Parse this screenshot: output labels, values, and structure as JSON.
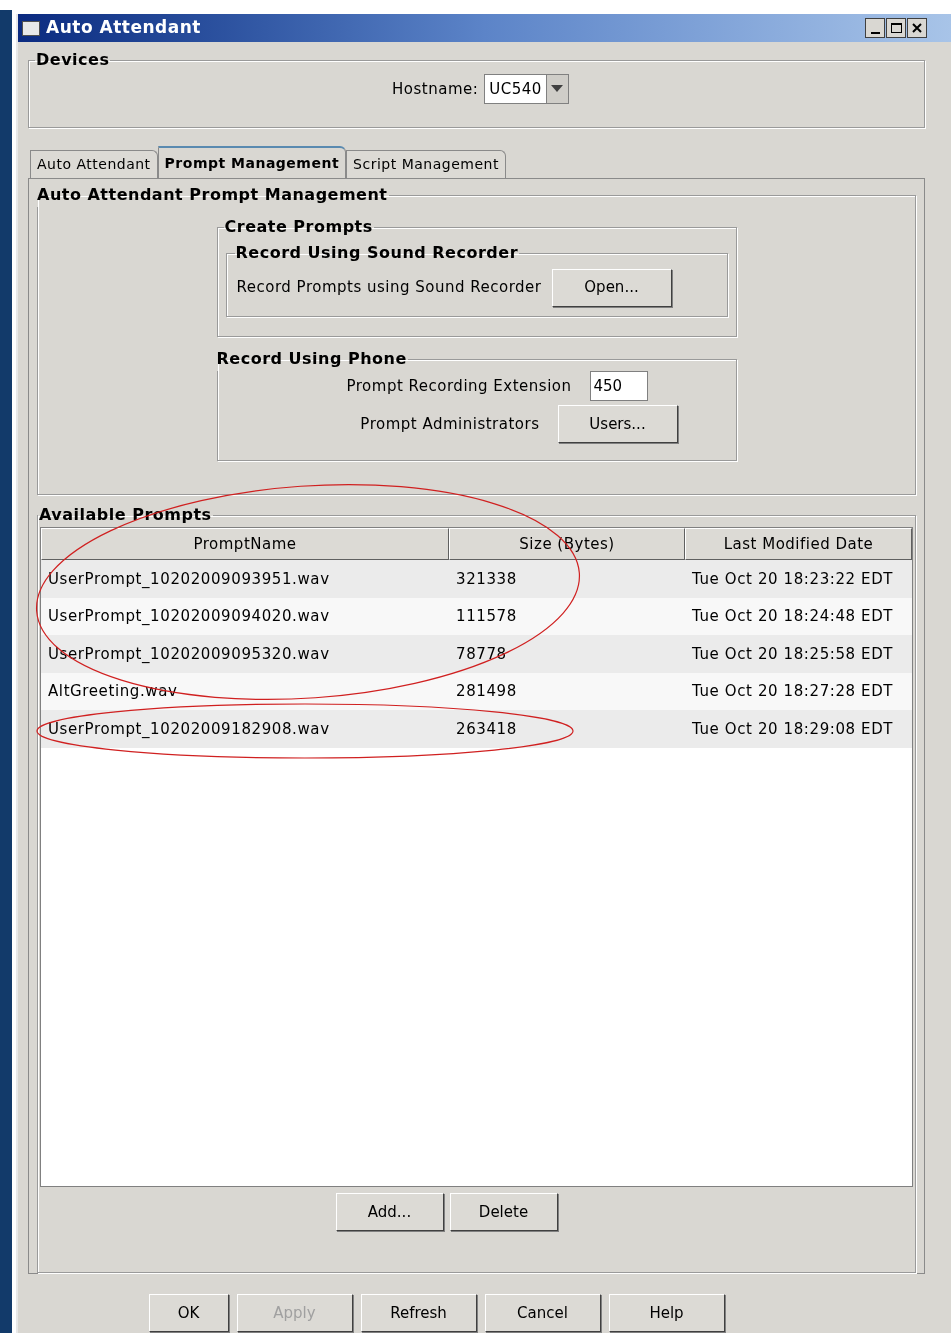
{
  "window": {
    "title": "Auto Attendant"
  },
  "devices": {
    "legend": "Devices",
    "hostname_label": "Hostname:",
    "hostname_value": "UC540"
  },
  "tabs": [
    {
      "label": "Auto Attendant",
      "selected": false
    },
    {
      "label": "Prompt Management",
      "selected": true
    },
    {
      "label": "Script Management",
      "selected": false
    }
  ],
  "prompt_management": {
    "legend": "Auto Attendant Prompt Management",
    "create_prompts": {
      "legend": "Create Prompts",
      "sound_recorder": {
        "legend": "Record Using Sound Recorder",
        "label": "Record Prompts using Sound Recorder",
        "button": "Open..."
      }
    },
    "phone": {
      "legend": "Record Using Phone",
      "extension_label": "Prompt Recording Extension",
      "extension_value": "450",
      "admins_label": "Prompt Administrators",
      "admins_button": "Users..."
    }
  },
  "available_prompts": {
    "legend": "Available Prompts",
    "columns": [
      "PromptName",
      "Size (Bytes)",
      "Last Modified Date"
    ],
    "rows": [
      [
        "UserPrompt_10202009093951.wav",
        "321338",
        "Tue Oct 20 18:23:22 EDT"
      ],
      [
        "UserPrompt_10202009094020.wav",
        "111578",
        "Tue Oct 20 18:24:48 EDT"
      ],
      [
        "UserPrompt_10202009095320.wav",
        "78778",
        "Tue Oct 20 18:25:58 EDT"
      ],
      [
        "AltGreeting.wav",
        "281498",
        "Tue Oct 20 18:27:28 EDT"
      ],
      [
        "UserPrompt_10202009182908.wav",
        "263418",
        "Tue Oct 20 18:29:08 EDT"
      ]
    ],
    "buttons": [
      "Add...",
      "Delete"
    ]
  },
  "buttons": [
    {
      "label": "OK",
      "disabled": false
    },
    {
      "label": "Apply",
      "disabled": true
    },
    {
      "label": "Refresh",
      "disabled": false
    },
    {
      "label": "Cancel",
      "disabled": false
    },
    {
      "label": "Help",
      "disabled": false
    }
  ]
}
